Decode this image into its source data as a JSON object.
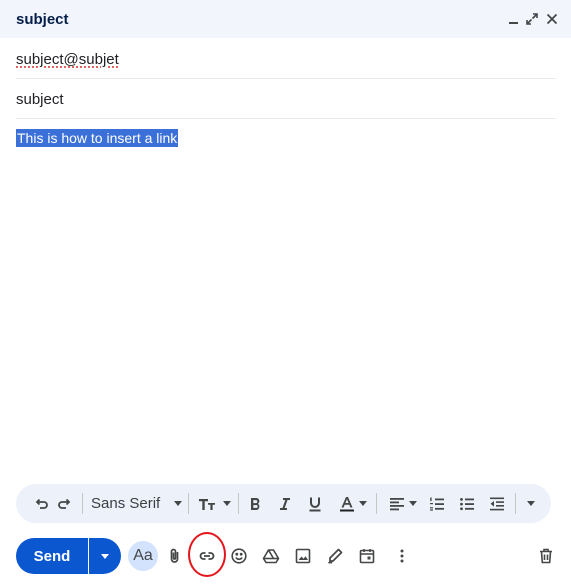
{
  "window": {
    "title": "subject",
    "minimize_icon": "minimize-icon",
    "popout_icon": "popout-icon",
    "close_icon": "close-icon"
  },
  "compose": {
    "to": "subject@subjet",
    "subject": "subject",
    "body_selected_text": "This is how to insert a link"
  },
  "format_toolbar": {
    "undo": "undo-icon",
    "redo": "redo-icon",
    "font": "Sans Serif",
    "text_size": "text-size-icon",
    "bold": "bold-icon",
    "italic": "italic-icon",
    "underline": "underline-icon",
    "text_color": "text-color-icon",
    "align": "align-icon",
    "numbered_list": "numbered-list-icon",
    "bulleted_list": "bulleted-list-icon",
    "indent_less": "indent-less-icon",
    "more": "more-formatting-icon"
  },
  "bottom_toolbar": {
    "send_label": "Send",
    "formatting_label": "Aa",
    "attach": "paperclip-icon",
    "insert_link": "link-icon",
    "emoji": "emoji-icon",
    "drive": "drive-icon",
    "photo": "image-icon",
    "signature": "pen-icon",
    "schedule": "calendar-icon",
    "more_options": "more-vert-icon",
    "discard": "trash-icon"
  },
  "annotation": {
    "highlight_color": "#e4141b"
  },
  "colors": {
    "accent": "#0b57d0",
    "header_bg": "#f2f6fc",
    "toolbar_bg": "#edf2fa",
    "selection": "#3b70d8"
  }
}
